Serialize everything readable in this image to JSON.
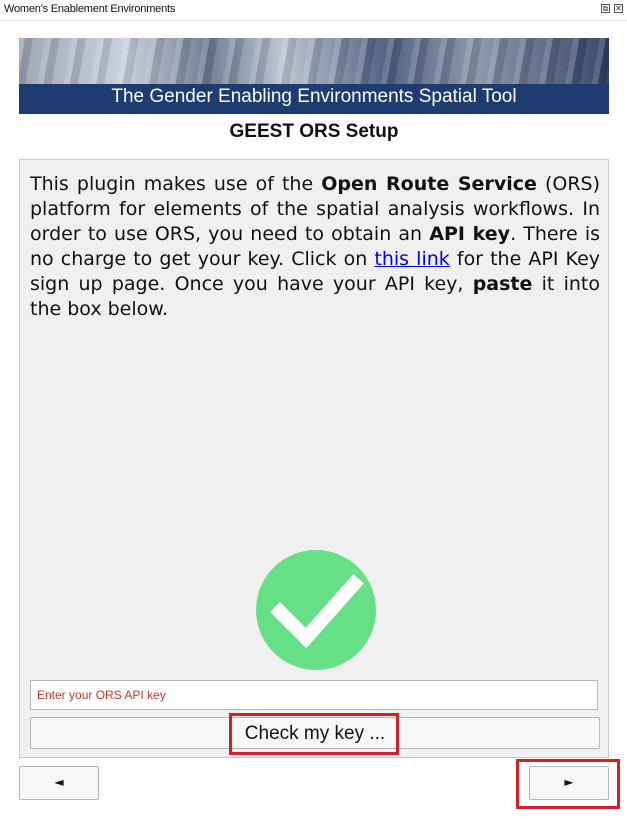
{
  "window": {
    "title": "Women's Enablement Environments",
    "float_glyph": "⧉",
    "close_glyph": "✕"
  },
  "banner": {
    "caption": "The Gender Enabling Environments Spatial Tool"
  },
  "page": {
    "title": "GEEST ORS Setup"
  },
  "description": {
    "t1": "This plugin makes use of the ",
    "b1": "Open Route Service",
    "t2": " (ORS) platform for elements of the spatial analysis workflows. In order to use ORS, you need to obtain an ",
    "b2": "API key",
    "t3": ". There is no charge to get your key. Click on ",
    "link": "this link",
    "t4": " for the API Key sign up page. Once you have your API key, ",
    "b3": "paste",
    "t5": " it into the box below."
  },
  "status": {
    "icon": "check-icon",
    "color": "#66e086"
  },
  "api_key": {
    "placeholder": "Enter your ORS API key",
    "value": ""
  },
  "buttons": {
    "check_key": "Check my key ...",
    "prev_glyph": "◄",
    "next_glyph": "►"
  },
  "highlights": {
    "color": "#d3202a"
  }
}
